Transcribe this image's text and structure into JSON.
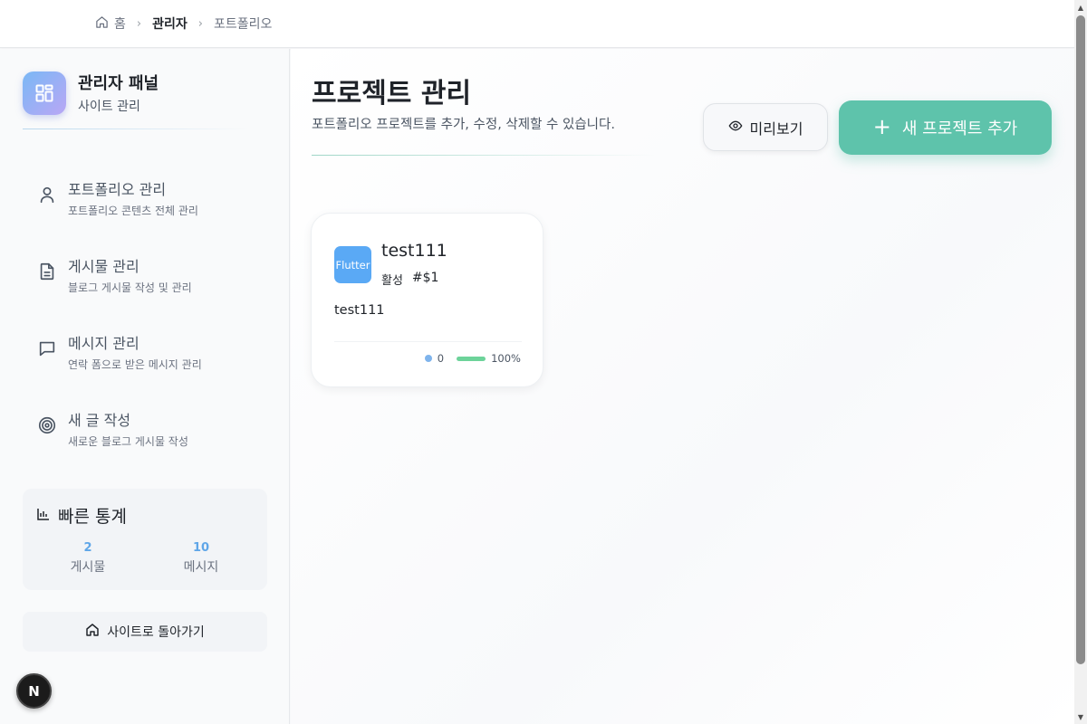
{
  "breadcrumb": {
    "home": "홈",
    "admin": "관리자",
    "current": "포트폴리오"
  },
  "sidebar": {
    "brand_title": "관리자 패널",
    "brand_subtitle": "사이트 관리",
    "items": [
      {
        "label": "포트폴리오 관리",
        "sub": "포트폴리오 콘텐츠 전체 관리",
        "icon": "user-icon"
      },
      {
        "label": "게시물 관리",
        "sub": "블로그 게시물 작성 및 관리",
        "icon": "document-icon"
      },
      {
        "label": "메시지 관리",
        "sub": "연락 폼으로 받은 메시지 관리",
        "icon": "message-icon"
      },
      {
        "label": "새 글 작성",
        "sub": "새로운 블로그 게시물 작성",
        "icon": "target-icon"
      }
    ],
    "stats": {
      "title": "빠른 통계",
      "posts_value": "2",
      "posts_label": "게시물",
      "messages_value": "10",
      "messages_label": "메시지"
    },
    "back_label": "사이트로 돌아가기",
    "badge": "N"
  },
  "main": {
    "title": "프로젝트 관리",
    "description": "포트폴리오 프로젝트를 추가, 수정, 삭제할 수 있습니다.",
    "preview_label": "미리보기",
    "add_label": "새 프로젝트 추가",
    "add_plus": "+"
  },
  "projects": [
    {
      "icon_text": "Flutter",
      "title": "test111",
      "status": "활성",
      "number": "#$1",
      "description": "test111",
      "count": "0",
      "progress_label": "100%",
      "progress": 1.0
    }
  ],
  "colors": {
    "accent": "#5ec3ab",
    "stat_blue": "#5fa6e8",
    "project_icon": "#5aa9f5",
    "progress": "#6dd39a"
  }
}
